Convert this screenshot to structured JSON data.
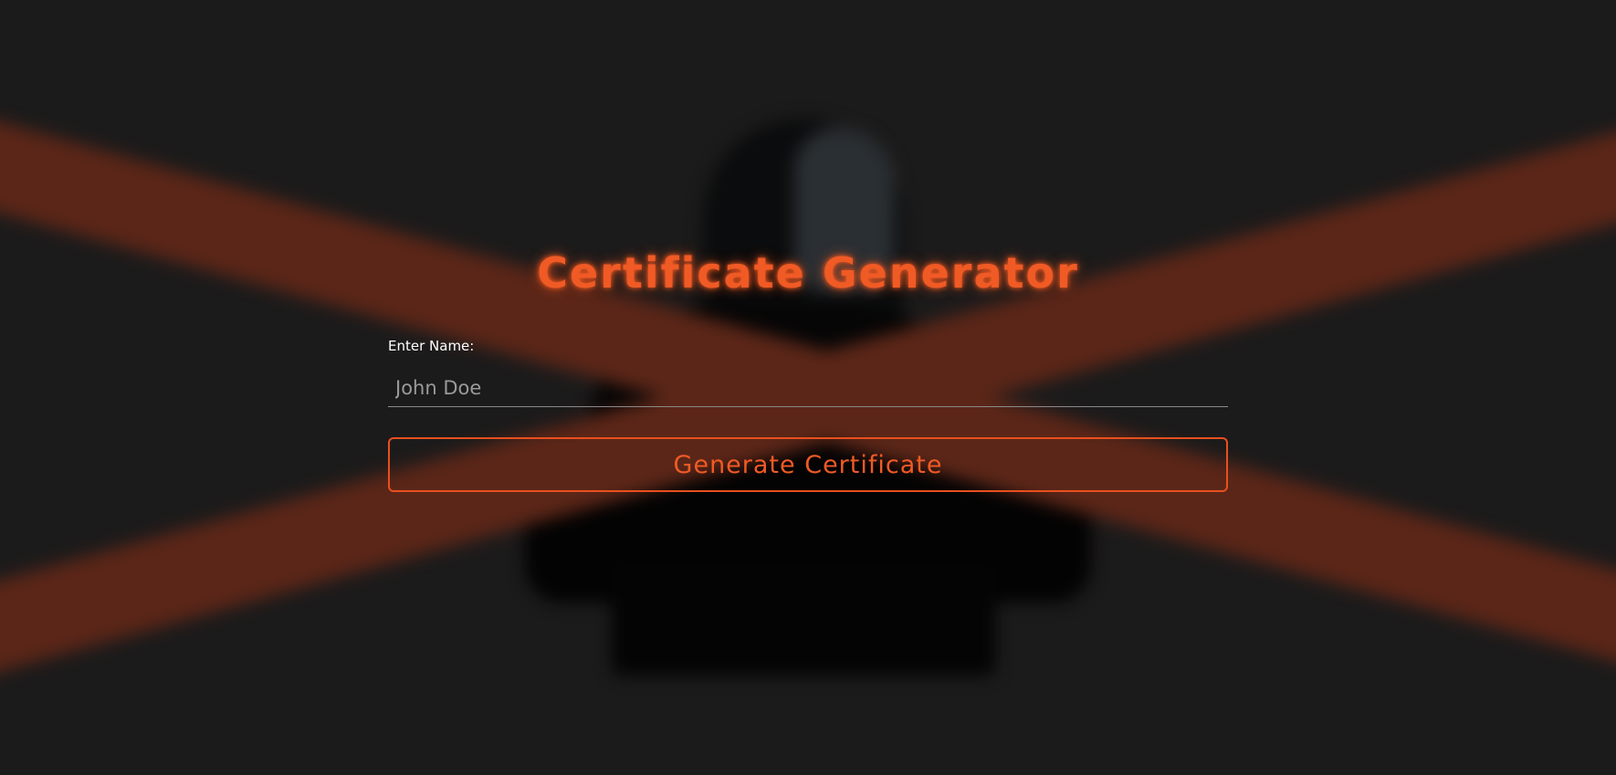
{
  "page": {
    "title": "Certificate Generator"
  },
  "form": {
    "name_label": "Enter Name:",
    "name_placeholder": "John Doe",
    "name_value": "",
    "submit_label": "Generate Certificate"
  },
  "colors": {
    "accent": "#f05a25",
    "background": "#1c1b1b",
    "tape": "#5b2618",
    "label": "#ffffff",
    "input_underline": "#8a8a8a"
  }
}
